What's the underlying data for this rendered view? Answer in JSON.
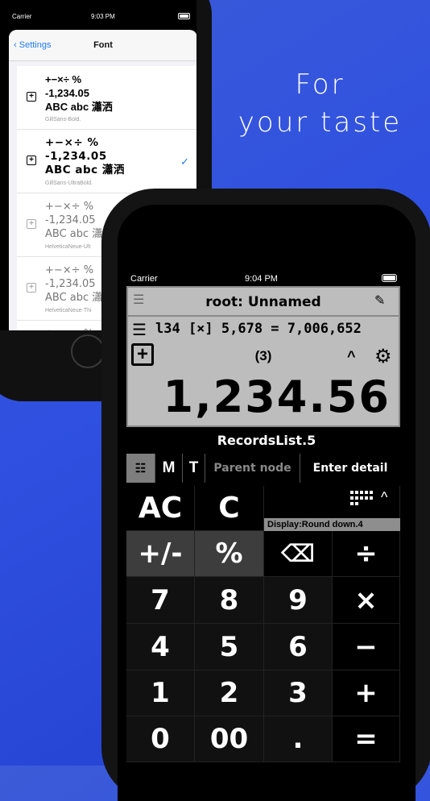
{
  "tagline": {
    "line1": "For",
    "line2": "your taste"
  },
  "back_phone": {
    "status": {
      "carrier": "Carrier",
      "time": "9:03 PM"
    },
    "nav": {
      "back_label": "Settings",
      "title": "Font"
    },
    "fonts": [
      {
        "sample_l1": "+−×÷ %",
        "sample_l2": "-1,234.05",
        "sample_l3": "ABC abc 瀟洒",
        "name": "GillSans-Bold.",
        "selected": false
      },
      {
        "sample_l1": "+−×÷ %",
        "sample_l2": "-1,234.05",
        "sample_l3": "ABC abc 瀟洒",
        "name": "GillSans-UltraBold.",
        "selected": true
      },
      {
        "sample_l1": "+−×÷ %",
        "sample_l2": "-1,234.05",
        "sample_l3": "ABC abc 瀟",
        "name": "HelveticaNeue-Ult",
        "selected": false
      },
      {
        "sample_l1": "+−×÷ %",
        "sample_l2": "-1,234.05",
        "sample_l3": "ABC abc 瀟",
        "name": "HelveticaNeue-Thi",
        "selected": false
      },
      {
        "sample_l1": "+−×÷ %",
        "sample_l2": "",
        "sample_l3": "",
        "name": "",
        "selected": false
      }
    ]
  },
  "front_phone": {
    "status": {
      "carrier": "Carrier",
      "time": "9:04 PM"
    },
    "lcd": {
      "title": "root: Unnamed",
      "formula": "l34 [×] 5,678 = 7,006,652",
      "count": "(3)",
      "value": "1,234.56"
    },
    "records_label": "RecordsList.5",
    "toolbar": {
      "m": "M",
      "t": "T",
      "parent": "Parent node",
      "detail": "Enter detail"
    },
    "display_mode": "Display:Round down.4",
    "keys": {
      "ac": "AC",
      "c": "C",
      "pm": "+/-",
      "pct": "%",
      "div": "÷",
      "k7": "7",
      "k8": "8",
      "k9": "9",
      "mul": "×",
      "k4": "4",
      "k5": "5",
      "k6": "6",
      "sub": "−",
      "k1": "1",
      "k2": "2",
      "k3": "3",
      "add": "+",
      "k0": "0",
      "k00": "00",
      "dot": ".",
      "eq": "="
    }
  }
}
